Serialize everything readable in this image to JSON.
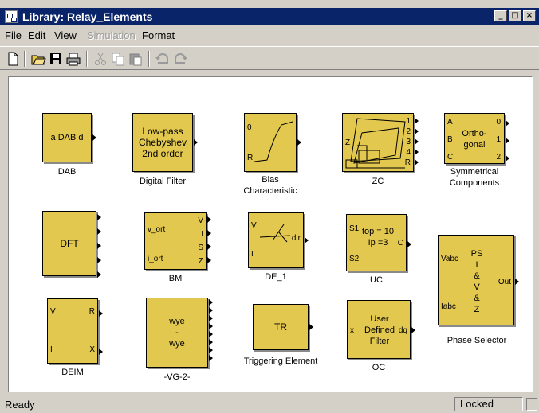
{
  "window": {
    "title": "Library: Relay_Elements"
  },
  "menu": {
    "file": "File",
    "edit": "Edit",
    "view": "View",
    "simulation": "Simulation",
    "format": "Format"
  },
  "toolbar": {
    "icons": [
      "new-icon",
      "open-icon",
      "save-icon",
      "print-icon",
      "cut-icon",
      "copy-icon",
      "paste-icon",
      "undo-icon",
      "redo-icon"
    ]
  },
  "blocks": {
    "dab": {
      "text": "a  DAB  d",
      "label": "DAB"
    },
    "digital_filter": {
      "text": "Low-pass\nChebyshev\n2nd order",
      "label": "Digital Filter"
    },
    "bias": {
      "in0": "0",
      "in1": "R",
      "label": "Bias\nCharacteristic"
    },
    "zc": {
      "in": "Z",
      "outs": [
        "1",
        "2",
        "3",
        "4",
        "R"
      ],
      "label": "ZC"
    },
    "symmetrical": {
      "ins": [
        "A",
        "B",
        "C"
      ],
      "text": "Ortho-\ngonal",
      "outs": [
        "0",
        "1",
        "2"
      ],
      "label": "Symmetrical\nComponents"
    },
    "dft": {
      "text": "DFT"
    },
    "bm": {
      "ins": [
        "v_ort",
        "i_ort"
      ],
      "outs": [
        "V",
        "I",
        "S",
        "Z"
      ],
      "label": "BM"
    },
    "de1": {
      "in0": "V",
      "in1": "I",
      "text": "dir",
      "label": "DE_1"
    },
    "uc": {
      "ins": [
        "S1",
        "S2"
      ],
      "text": "top = 10\nIp =3",
      "out": "C",
      "label": "UC"
    },
    "phase_selector": {
      "in0": "Vabc",
      "in1": "Iabc",
      "text": "PS\nI\n&\nV\n&\nZ",
      "out": "Out",
      "label": "Phase Selector"
    },
    "deim": {
      "ins": [
        "V",
        "I"
      ],
      "outs": [
        "R",
        "X"
      ],
      "label": "DEIM"
    },
    "vg2": {
      "text": "wye\n-\nwye",
      "label": "-VG-2-"
    },
    "tr": {
      "text": "TR",
      "label": "Triggering Element"
    },
    "oc": {
      "in": "x",
      "text": "User\nDefined\nFilter",
      "out": "dq",
      "label": "OC"
    }
  },
  "status": {
    "text": "Ready",
    "locked": "Locked"
  }
}
